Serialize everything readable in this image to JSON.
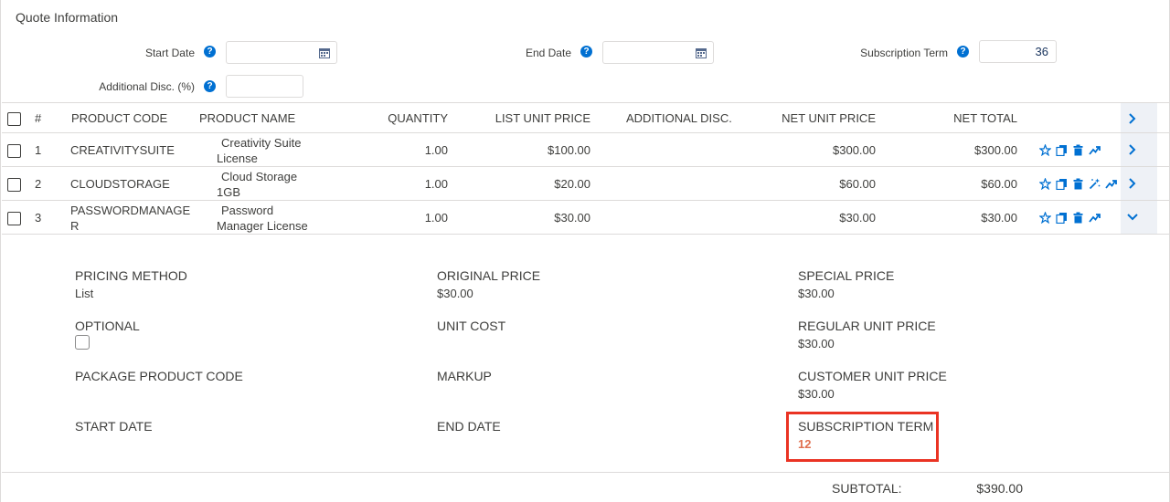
{
  "section": {
    "title": "Quote Information"
  },
  "fields": {
    "start_date": {
      "label": "Start Date",
      "value": ""
    },
    "end_date": {
      "label": "End Date",
      "value": ""
    },
    "subscription_term": {
      "label": "Subscription Term",
      "value": "36"
    },
    "additional_disc": {
      "label": "Additional Disc. (%)",
      "value": ""
    }
  },
  "table": {
    "headers": {
      "num": "#",
      "product_code": "PRODUCT CODE",
      "product_name": "PRODUCT NAME",
      "quantity": "QUANTITY",
      "list_unit_price": "LIST UNIT PRICE",
      "additional_disc": "ADDITIONAL DISC.",
      "net_unit_price": "NET UNIT PRICE",
      "net_total": "NET TOTAL"
    },
    "rows": [
      {
        "num": "1",
        "code": "CREATIVITYSUITE",
        "name": "Creativity Suite License",
        "quantity": "1.00",
        "list_price": "$100.00",
        "disc": "",
        "net_unit": "$300.00",
        "net_total": "$300.00"
      },
      {
        "num": "2",
        "code": "CLOUDSTORAGE",
        "name": "Cloud Storage 1GB",
        "quantity": "1.00",
        "list_price": "$20.00",
        "disc": "",
        "net_unit": "$60.00",
        "net_total": "$60.00"
      },
      {
        "num": "3",
        "code": "PASSWORDMANAGER",
        "name": "Password Manager License",
        "quantity": "1.00",
        "list_price": "$30.00",
        "disc": "",
        "net_unit": "$30.00",
        "net_total": "$30.00"
      }
    ]
  },
  "details": {
    "pricing_method": {
      "label": "PRICING METHOD",
      "value": "List"
    },
    "original_price": {
      "label": "ORIGINAL PRICE",
      "value": "$30.00"
    },
    "special_price": {
      "label": "SPECIAL PRICE",
      "value": "$30.00"
    },
    "optional": {
      "label": "OPTIONAL"
    },
    "unit_cost": {
      "label": "UNIT COST",
      "value": ""
    },
    "regular_unit_price": {
      "label": "REGULAR UNIT PRICE",
      "value": "$30.00"
    },
    "package_product_code": {
      "label": "PACKAGE PRODUCT CODE",
      "value": ""
    },
    "markup": {
      "label": "MARKUP",
      "value": ""
    },
    "customer_unit_price": {
      "label": "CUSTOMER UNIT PRICE",
      "value": "$30.00"
    },
    "start_date": {
      "label": "START DATE",
      "value": ""
    },
    "end_date": {
      "label": "END DATE",
      "value": ""
    },
    "subscription_term": {
      "label": "SUBSCRIPTION TERM",
      "value": "12"
    }
  },
  "summary": {
    "subtotal_label": "SUBTOTAL:",
    "subtotal_value": "$390.00"
  },
  "colors": {
    "accent": "#0070d2",
    "highlight_box": "#ea3323",
    "highlight_value": "#e07050"
  }
}
